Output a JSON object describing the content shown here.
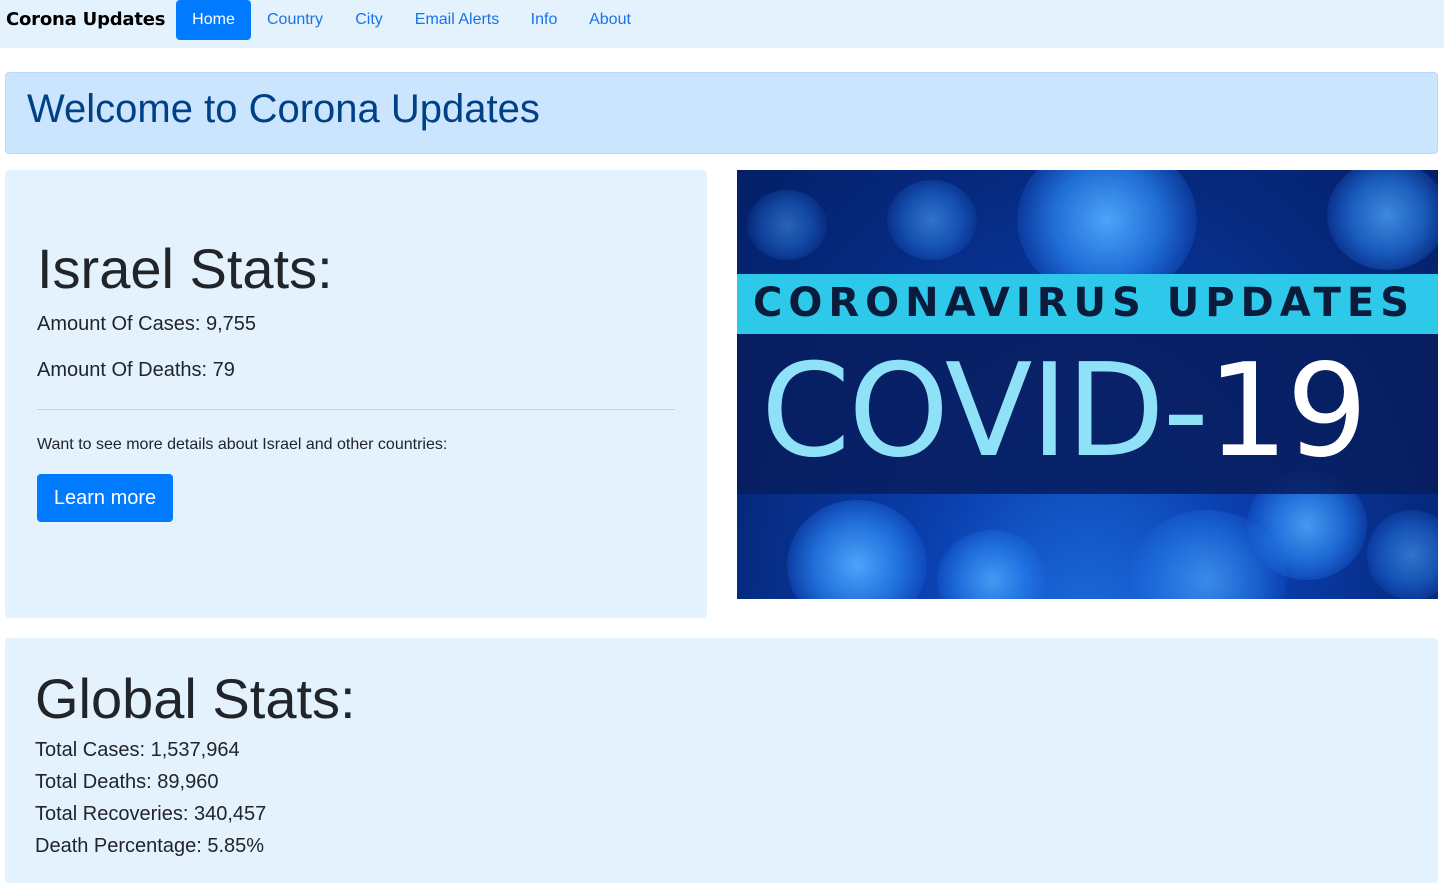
{
  "navbar": {
    "brand": "Corona Updates",
    "items": [
      "Home",
      "Country",
      "City",
      "Email Alerts",
      "Info",
      "About"
    ],
    "active": "Home"
  },
  "welcome": {
    "title": "Welcome to Corona Updates"
  },
  "israel": {
    "title": "Israel Stats:",
    "cases_label": "Amount Of Cases: 9,755",
    "deaths_label": "Amount Of Deaths: 79",
    "more_text": "Want to see more details about Israel and other countries:",
    "button_label": "Learn more"
  },
  "banner": {
    "top_text": "CORONAVIRUS UPDATES",
    "covid": "COVID-",
    "number": "19"
  },
  "global": {
    "title": "Global Stats:",
    "total_cases": "Total Cases: 1,537,964",
    "total_deaths": "Total Deaths: 89,960",
    "total_recoveries": "Total Recoveries: 340,457",
    "death_percentage": "Death Percentage: 5.85%"
  },
  "colors": {
    "navbar_bg": "#e3f2fd",
    "primary": "#007bff",
    "alert_bg": "#cce5ff",
    "alert_text": "#004085",
    "card_bg": "#e3f2fd"
  }
}
